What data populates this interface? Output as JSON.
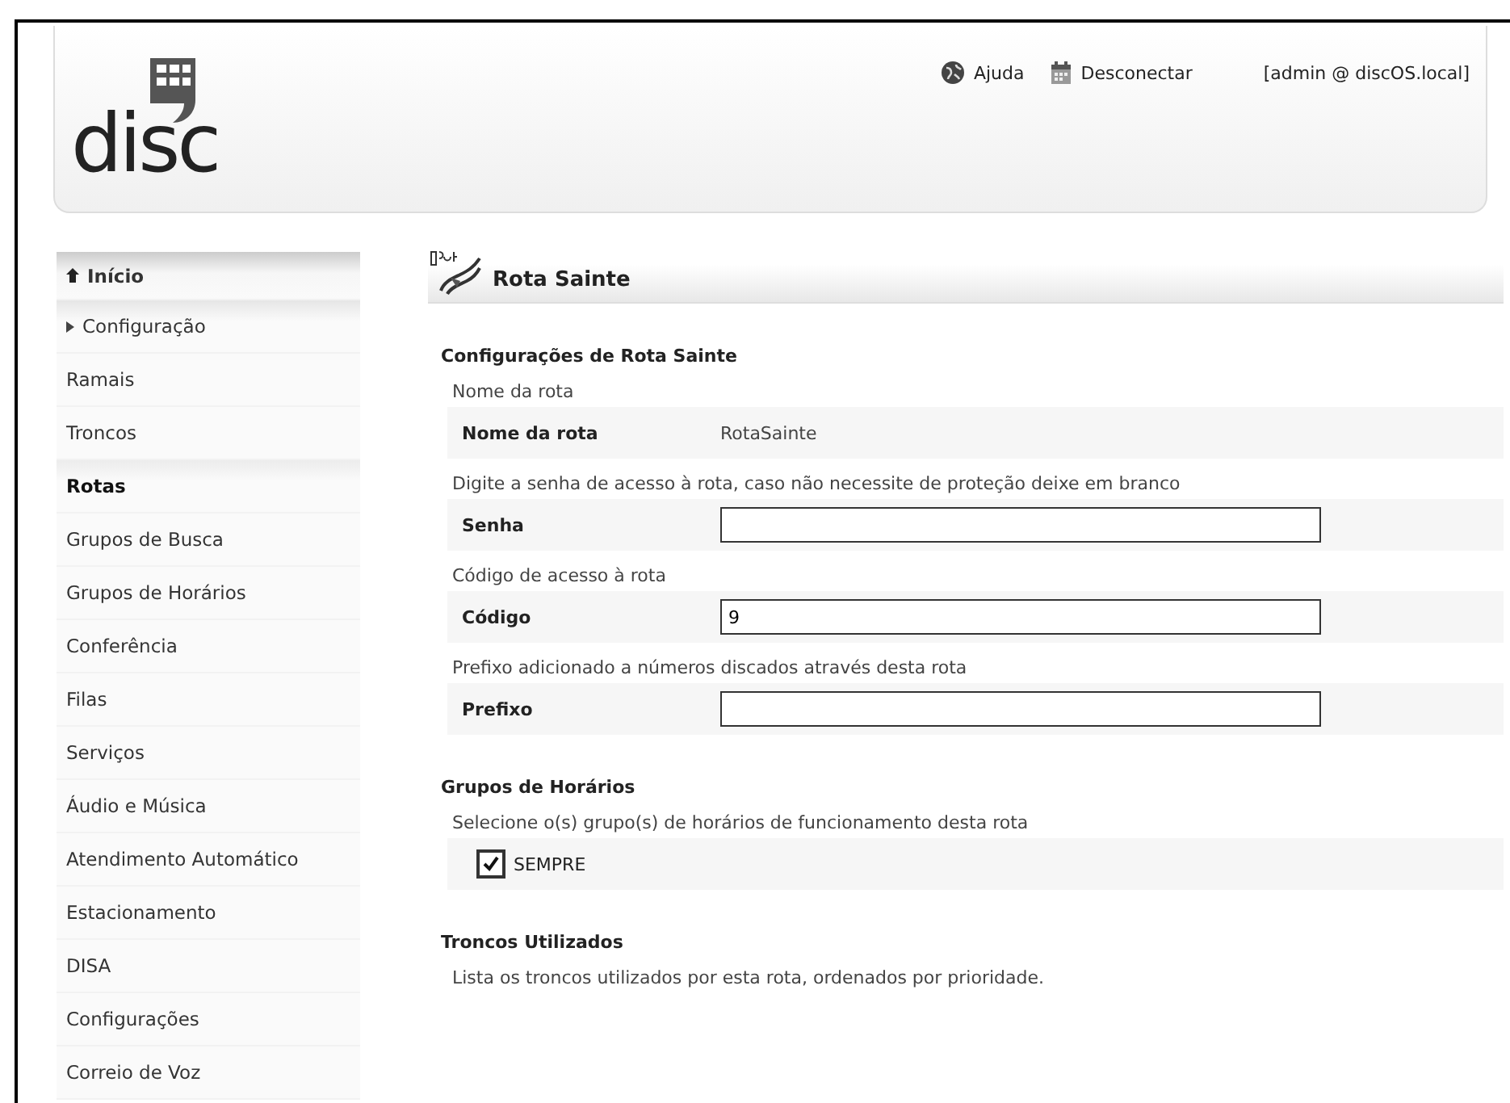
{
  "header": {
    "logo": "disc",
    "links": [
      {
        "kind": "help",
        "label": "Ajuda"
      },
      {
        "kind": "logout",
        "label": "Desconectar"
      }
    ],
    "user": "[admin @ discOS.local]"
  },
  "sidebar": {
    "items": [
      {
        "kind": "home",
        "label": "Início",
        "selected": false
      },
      {
        "kind": "group",
        "label": "Configuração",
        "selected": false
      },
      {
        "kind": "item",
        "label": "Ramais",
        "selected": false
      },
      {
        "kind": "item",
        "label": "Troncos",
        "selected": false
      },
      {
        "kind": "item",
        "label": "Rotas",
        "selected": true
      },
      {
        "kind": "item",
        "label": "Grupos de Busca",
        "selected": false
      },
      {
        "kind": "item",
        "label": "Grupos de Horários",
        "selected": false
      },
      {
        "kind": "item",
        "label": "Conferência",
        "selected": false
      },
      {
        "kind": "item",
        "label": "Filas",
        "selected": false
      },
      {
        "kind": "item",
        "label": "Serviços",
        "selected": false
      },
      {
        "kind": "item",
        "label": "Áudio e Música",
        "selected": false
      },
      {
        "kind": "item",
        "label": "Atendimento Automático",
        "selected": false
      },
      {
        "kind": "item",
        "label": "Estacionamento",
        "selected": false
      },
      {
        "kind": "item",
        "label": "DISA",
        "selected": false
      },
      {
        "kind": "item",
        "label": "Configurações",
        "selected": false
      },
      {
        "kind": "item",
        "label": "Correio de Voz",
        "selected": false
      }
    ]
  },
  "page": {
    "title": "Rota Sainte",
    "sections": [
      {
        "heading": "Configurações de Rota Sainte",
        "fields": [
          {
            "kind": "static",
            "description": "Nome da rota",
            "label": "Nome da rota",
            "value": "RotaSainte"
          },
          {
            "kind": "input",
            "description": "Digite a senha de acesso à rota, caso não necessite de proteção deixe em branco",
            "label": "Senha"
          },
          {
            "kind": "input",
            "description": "Código de acesso à rota",
            "label": "Código",
            "value": "9"
          },
          {
            "kind": "input",
            "description": "Prefixo adicionado a números discados através desta rota",
            "label": "Prefixo"
          }
        ]
      },
      {
        "heading": "Grupos de Horários",
        "fields": [
          {
            "kind": "checkbox",
            "description": "Selecione o(s) grupo(s) de horários de funcionamento desta rota",
            "label": "SEMPRE",
            "checked": true
          }
        ]
      },
      {
        "heading": "Troncos Utilizados",
        "fields": [
          {
            "kind": "note",
            "description": "Lista os troncos utilizados por esta rota, ordenados por prioridade."
          }
        ]
      }
    ]
  }
}
